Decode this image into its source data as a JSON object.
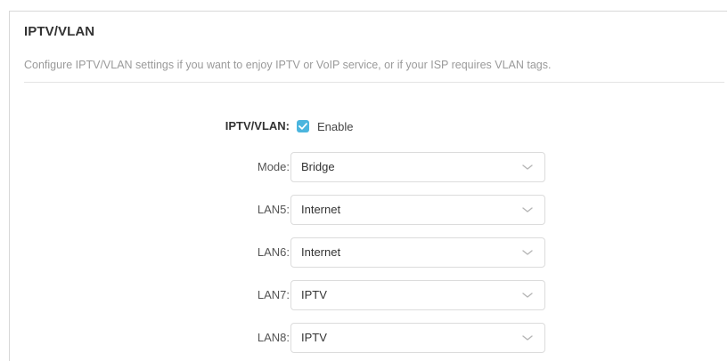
{
  "section": {
    "title": "IPTV/VLAN",
    "description": "Configure IPTV/VLAN settings if you want to enjoy IPTV or VoIP service, or if your ISP requires VLAN tags."
  },
  "iptv_vlan": {
    "label": "IPTV/VLAN:",
    "checkbox_label": "Enable",
    "checked": true
  },
  "fields": [
    {
      "label": "Mode:",
      "value": "Bridge"
    },
    {
      "label": "LAN5:",
      "value": "Internet"
    },
    {
      "label": "LAN6:",
      "value": "Internet"
    },
    {
      "label": "LAN7:",
      "value": "IPTV"
    },
    {
      "label": "LAN8:",
      "value": "IPTV"
    }
  ],
  "colors": {
    "accent": "#4bb5de",
    "description_text": "#9a9a9a"
  },
  "icons": {
    "checkbox": "checkmark-icon",
    "select_arrow": "chevron-down-icon"
  }
}
